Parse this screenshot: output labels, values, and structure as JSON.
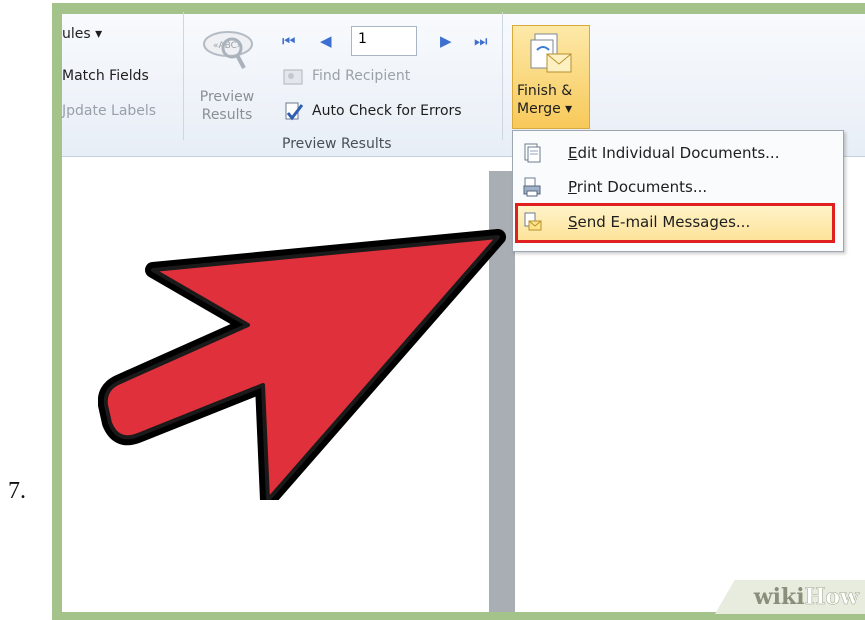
{
  "step_number": "7.",
  "ribbon": {
    "left_col": [
      "ules ▾",
      "Match Fields",
      "Jpdate Labels"
    ],
    "preview_btn": [
      "Preview",
      "Results"
    ],
    "record_value": "1",
    "find_recipient": "Find Recipient",
    "auto_check": "Auto Check for Errors",
    "group_label": "Preview Results",
    "finish_merge": [
      "Finish &",
      "Merge ▾"
    ]
  },
  "menu": {
    "items": [
      {
        "label": "Edit Individual Documents...",
        "mnemonic": "E"
      },
      {
        "label": "Print Documents...",
        "mnemonic": "P"
      },
      {
        "label": "Send E-mail Messages...",
        "mnemonic": "S"
      }
    ],
    "highlighted_index": 2
  },
  "watermark": {
    "wiki": "wiki",
    "how": "How"
  },
  "colors": {
    "arrow": "#e0303c",
    "highlight_border": "#e02020",
    "frame": "#a4c38a"
  }
}
